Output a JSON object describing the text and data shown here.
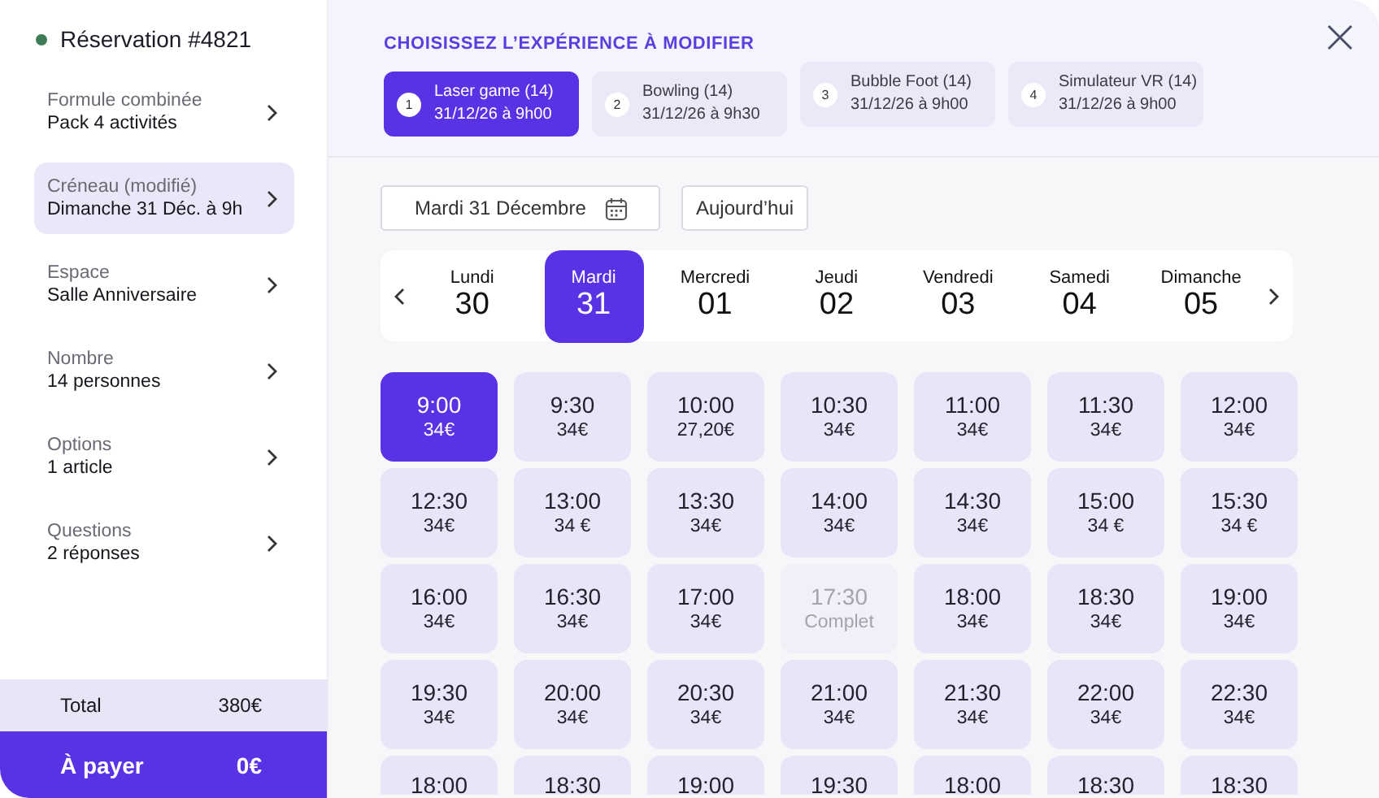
{
  "sidebar": {
    "title": "Réservation #4821",
    "items": [
      {
        "label": "Formule combinée",
        "value": "Pack 4 activités",
        "selected": false
      },
      {
        "label": "Créneau (modifié)",
        "value": "Dimanche 31 Déc. à 9h",
        "selected": true
      },
      {
        "label": "Espace",
        "value": "Salle Anniversaire",
        "selected": false
      },
      {
        "label": "Nombre",
        "value": "14 personnes",
        "selected": false
      },
      {
        "label": "Options",
        "value": "1 article",
        "selected": false
      },
      {
        "label": "Questions",
        "value": "2 réponses",
        "selected": false
      }
    ],
    "total": {
      "label": "Total",
      "value": "380€"
    },
    "to_pay": {
      "label": "À payer",
      "value": "0€"
    }
  },
  "header": {
    "title": "CHOISISSEZ L’EXPÉRIENCE À MODIFIER",
    "experiences": [
      {
        "number": "1",
        "name": "Laser game (14)",
        "datetime": "31/12/26 à 9h00",
        "selected": true
      },
      {
        "number": "2",
        "name": "Bowling (14)",
        "datetime": "31/12/26 à 9h30",
        "selected": false
      },
      {
        "number": "3",
        "name": "Bubble Foot (14)",
        "datetime": "31/12/26 à 9h00",
        "selected": false
      },
      {
        "number": "4",
        "name": "Simulateur VR (14)",
        "datetime": "31/12/26 à 9h00",
        "selected": false
      }
    ]
  },
  "date_field": {
    "value": "Mardi 31 Décembre"
  },
  "today_button": "Aujourd’hui",
  "days": [
    {
      "weekday": "Lundi",
      "day": "30",
      "selected": false
    },
    {
      "weekday": "Mardi",
      "day": "31",
      "selected": true
    },
    {
      "weekday": "Mercredi",
      "day": "01",
      "selected": false
    },
    {
      "weekday": "Jeudi",
      "day": "02",
      "selected": false
    },
    {
      "weekday": "Vendredi",
      "day": "03",
      "selected": false
    },
    {
      "weekday": "Samedi",
      "day": "04",
      "selected": false
    },
    {
      "weekday": "Dimanche",
      "day": "05",
      "selected": false
    }
  ],
  "slots": [
    {
      "time": "9:00",
      "price": "34€",
      "disabled": false,
      "selected": true
    },
    {
      "time": "9:30",
      "price": "34€",
      "disabled": false,
      "selected": false
    },
    {
      "time": "10:00",
      "price": "27,20€",
      "disabled": false,
      "selected": false
    },
    {
      "time": "10:30",
      "price": "34€",
      "disabled": false,
      "selected": false
    },
    {
      "time": "11:00",
      "price": "34€",
      "disabled": false,
      "selected": false
    },
    {
      "time": "11:30",
      "price": "34€",
      "disabled": false,
      "selected": false
    },
    {
      "time": "12:00",
      "price": "34€",
      "disabled": false,
      "selected": false
    },
    {
      "time": "12:30",
      "price": "34€",
      "disabled": false,
      "selected": false
    },
    {
      "time": "13:00",
      "price": "34 €",
      "disabled": false,
      "selected": false
    },
    {
      "time": "13:30",
      "price": "34€",
      "disabled": false,
      "selected": false
    },
    {
      "time": "14:00",
      "price": "34€",
      "disabled": false,
      "selected": false
    },
    {
      "time": "14:30",
      "price": "34€",
      "disabled": false,
      "selected": false
    },
    {
      "time": "15:00",
      "price": "34 €",
      "disabled": false,
      "selected": false
    },
    {
      "time": "15:30",
      "price": "34 €",
      "disabled": false,
      "selected": false
    },
    {
      "time": "16:00",
      "price": "34€",
      "disabled": false,
      "selected": false
    },
    {
      "time": "16:30",
      "price": "34€",
      "disabled": false,
      "selected": false
    },
    {
      "time": "17:00",
      "price": "34€",
      "disabled": false,
      "selected": false
    },
    {
      "time": "17:30",
      "price": "Complet",
      "disabled": true,
      "selected": false
    },
    {
      "time": "18:00",
      "price": "34€",
      "disabled": false,
      "selected": false
    },
    {
      "time": "18:30",
      "price": "34€",
      "disabled": false,
      "selected": false
    },
    {
      "time": "19:00",
      "price": "34€",
      "disabled": false,
      "selected": false
    },
    {
      "time": "19:30",
      "price": "34€",
      "disabled": false,
      "selected": false
    },
    {
      "time": "20:00",
      "price": "34€",
      "disabled": false,
      "selected": false
    },
    {
      "time": "20:30",
      "price": "34€",
      "disabled": false,
      "selected": false
    },
    {
      "time": "21:00",
      "price": "34€",
      "disabled": false,
      "selected": false
    },
    {
      "time": "21:30",
      "price": "34€",
      "disabled": false,
      "selected": false
    },
    {
      "time": "22:00",
      "price": "34€",
      "disabled": false,
      "selected": false
    },
    {
      "time": "22:30",
      "price": "34€",
      "disabled": false,
      "selected": false
    },
    {
      "time": "18:00",
      "disabled": false,
      "selected": false
    },
    {
      "time": "18:30",
      "disabled": false,
      "selected": false
    },
    {
      "time": "19:00",
      "disabled": false,
      "selected": false
    },
    {
      "time": "19:30",
      "disabled": false,
      "selected": false
    },
    {
      "time": "18:00",
      "disabled": false,
      "selected": false
    },
    {
      "time": "18:30",
      "disabled": false,
      "selected": false
    },
    {
      "time": "18:30",
      "disabled": false,
      "selected": false
    }
  ]
}
